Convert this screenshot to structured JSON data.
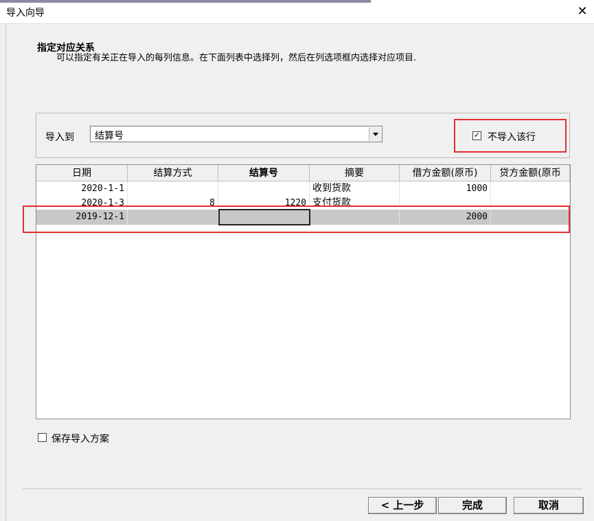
{
  "window": {
    "title": "导入向导",
    "close_symbol": "✕"
  },
  "header": {
    "title": "指定对应关系",
    "description": "可以指定有关正在导入的每列信息。在下面列表中选择列，然后在列选项框内选择对应项目."
  },
  "mapping": {
    "import_to_label": "导入到",
    "import_to_value": "结算号",
    "skip_row_label": "不导入该行",
    "skip_row_checked": true,
    "check_mark": "✓"
  },
  "grid": {
    "columns": [
      "日期",
      "结算方式",
      "结算号",
      "摘要",
      "借方金额(原币)",
      "贷方金额(原币"
    ],
    "active_column": 2,
    "rows": [
      {
        "date": "2020-1-1",
        "method": "",
        "number": "",
        "summary": "收到货款",
        "debit": "1000",
        "credit": ""
      },
      {
        "date": "2020-1-3",
        "method": "8",
        "number": "1220",
        "summary": "支付货款",
        "debit": "",
        "credit": ""
      },
      {
        "date": "2019-12-1",
        "method": "",
        "number": "",
        "summary": "",
        "debit": "2000",
        "credit": ""
      }
    ],
    "selected_row": 2
  },
  "save_scheme": {
    "label": "保存导入方案",
    "checked": false
  },
  "buttons": {
    "prev": "< 上一步",
    "finish": "完成",
    "cancel": "取消"
  },
  "colors": {
    "highlight_border": "#e0302e",
    "selected_row": "#c8c8c8"
  }
}
